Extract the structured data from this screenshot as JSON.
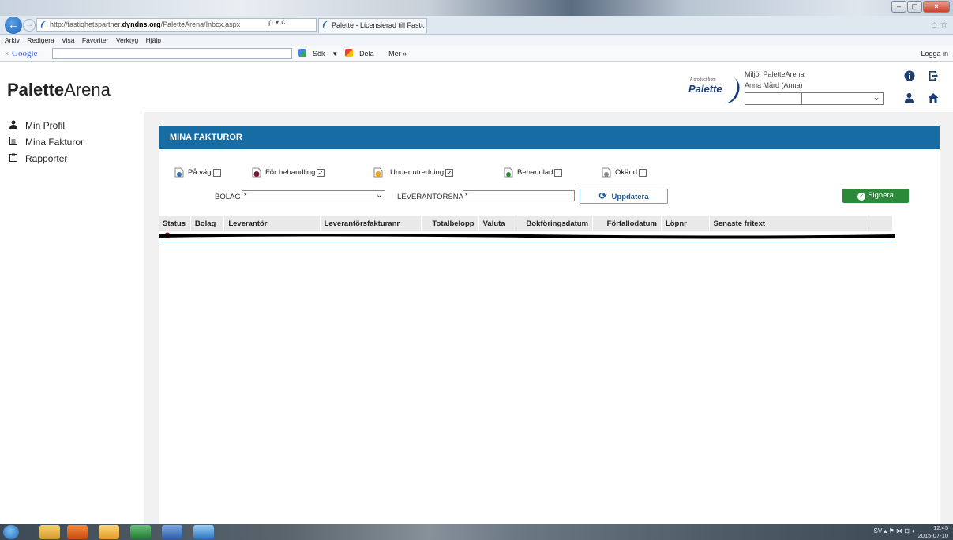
{
  "browser": {
    "url_prefix": "http://fastighetspartner.",
    "url_host": "dyndns.org",
    "url_path": "/PaletteArena/Inbox.aspx",
    "url_tools": "ρ ▾ ċ",
    "tab_title": "Palette - Licensierad till Fast...",
    "tab_close": "×",
    "menu": [
      "Arkiv",
      "Redigera",
      "Visa",
      "Favoriter",
      "Verktyg",
      "Hjälp"
    ],
    "google": {
      "close": "×",
      "logo": "Google",
      "search_label": "Sök",
      "share_label": "Dela",
      "more_label": "Mer »",
      "login_label": "Logga in"
    }
  },
  "app": {
    "brand_bold": "Palette",
    "brand_light": "Arena",
    "logo_small": "A product from",
    "logo_word": "Palette",
    "env_label": "Miljö: PaletteArena",
    "user_label": "Anna Mård (Anna)",
    "header_icons": [
      "info-icon",
      "logout-icon",
      "user-icon",
      "home-icon"
    ]
  },
  "sidebar": {
    "items": [
      {
        "label": "Min Profil",
        "icon": "user-icon"
      },
      {
        "label": "Mina Fakturor",
        "icon": "document-icon"
      },
      {
        "label": "Rapporter",
        "icon": "clipboard-icon"
      }
    ]
  },
  "panel": {
    "title": "MINA FAKTUROR",
    "filters": [
      {
        "label": "På väg",
        "checked": false,
        "color": "#2f6fb0"
      },
      {
        "label": "För behandling",
        "checked": true,
        "color": "#7a1838"
      },
      {
        "label": "Under utredning",
        "checked": true,
        "color": "#f0a21a"
      },
      {
        "label": "Behandlad",
        "checked": false,
        "color": "#2a8a3a"
      },
      {
        "label": "Okänd",
        "checked": false,
        "color": "#8a8a8a"
      }
    ],
    "bolag_label": "BOLAG",
    "bolag_value": "*",
    "leverantor_label": "LEVERANTÖRSNAMN",
    "leverantor_value": "*",
    "update_button": "Uppdatera",
    "sign_button": "Signera",
    "columns": [
      "Status",
      "Bolag",
      "Leverantör",
      "Leverantörsfakturanr",
      "Totalbelopp",
      "Valuta",
      "Bokföringsdatum",
      "Förfallodatum",
      "Löpnr",
      "Senaste fritext"
    ]
  },
  "taskbar": {
    "tray_icons": "SV  ▴  ⚑  ⋈  ⊡  ◖",
    "time": "12:45",
    "date": "2015-07-10"
  },
  "colors": {
    "panel_header": "#176ca3",
    "sign_button": "#2a8a3a",
    "header_icons": "#1b3e73"
  }
}
